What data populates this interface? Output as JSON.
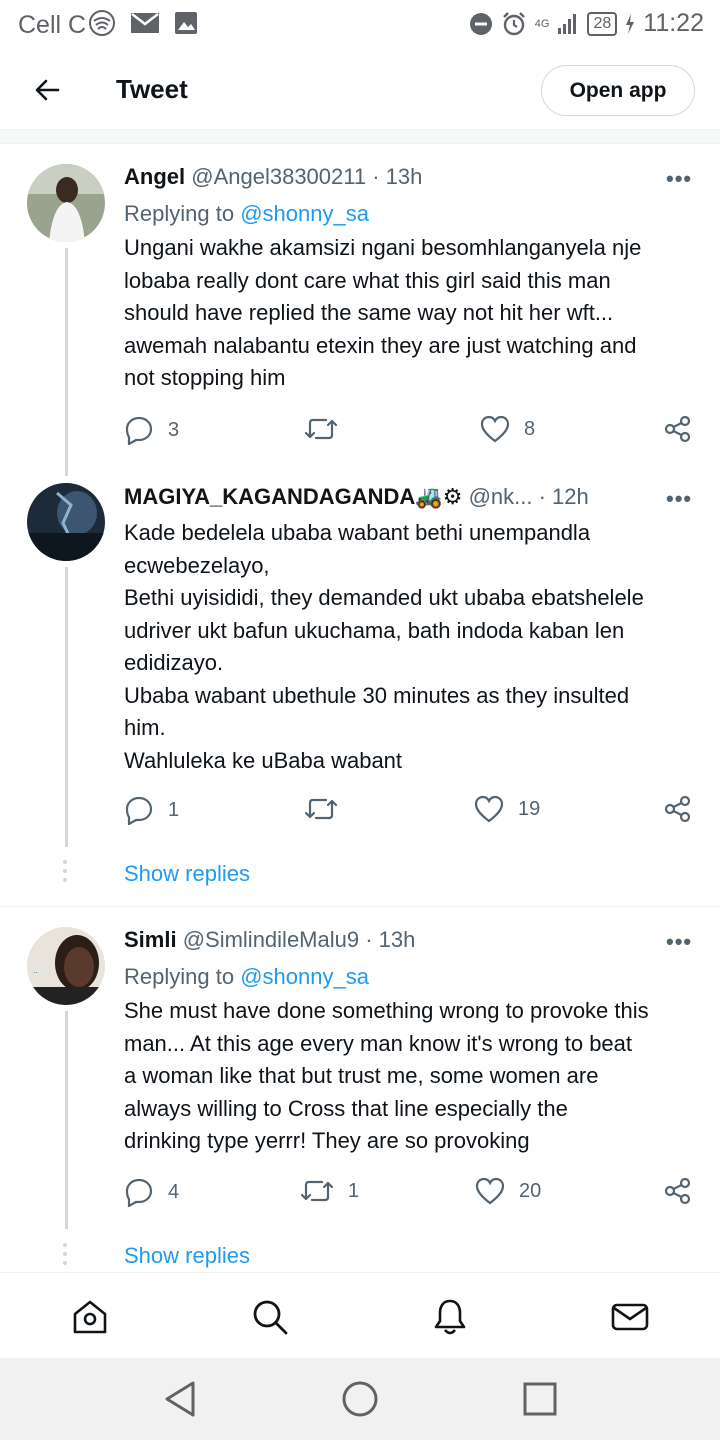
{
  "status_bar": {
    "carrier": "Cell C",
    "network": "4G",
    "battery": "28",
    "time": "11:22"
  },
  "header": {
    "title": "Tweet",
    "open_app_label": "Open app"
  },
  "tweets": [
    {
      "name": "Angel",
      "meta": "@Angel38300211 · 13h",
      "replying_prefix": "Replying to",
      "replying_handle": "@shonny_sa",
      "lines": [
        "Ungani wakhe akamsizi ngani besomhlanganyela nje",
        "lobaba really dont care what this girl said this man",
        "should have replied the same way not hit her wft...",
        "awemah nalabantu etexin they are just watching and",
        "not stopping him"
      ],
      "reply_count": "3",
      "retweet_count": "",
      "like_count": "8"
    },
    {
      "name": "MAGIYA_KAGANDAGANDA🚜⚙",
      "meta": "@nk... · 12h",
      "lines": [
        "Kade bedelela ubaba wabant bethi unempandla",
        "ecwebezelayo,",
        "Bethi uyisididi, they demanded ukt ubaba ebatshelele",
        "udriver ukt bafun ukuchama, bath indoda kaban len",
        "edidizayo.",
        "Ubaba wabant ubethule 30 minutes as they insulted",
        "him.",
        "Wahluleka ke uBaba wabant"
      ],
      "reply_count": "1",
      "retweet_count": "",
      "like_count": "19",
      "show_replies": "Show replies"
    },
    {
      "name": "Simli",
      "meta": "@SimlindileMalu9 · 13h",
      "replying_prefix": "Replying to",
      "replying_handle": "@shonny_sa",
      "lines": [
        "She must have done something wrong to provoke this",
        "man... At this age every man know it's wrong to beat",
        "a woman like that but trust me, some women are",
        "always willing to Cross that line especially the",
        "drinking type yerrr! They are so provoking"
      ],
      "reply_count": "4",
      "retweet_count": "1",
      "like_count": "20",
      "show_replies": "Show replies"
    }
  ],
  "more_label": "•••",
  "icons": {
    "back": "arrow-left-icon",
    "reply": "speech-bubble-icon",
    "retweet": "retweet-icon",
    "like": "heart-icon",
    "share": "share-icon",
    "nav": [
      "home-icon",
      "search-icon",
      "bell-icon",
      "mail-icon"
    ],
    "system": [
      "back-triangle-icon",
      "home-circle-icon",
      "recents-square-icon"
    ]
  },
  "colors": {
    "accent": "#1d9bf0",
    "text": "#0f1419",
    "muted": "#536471"
  }
}
